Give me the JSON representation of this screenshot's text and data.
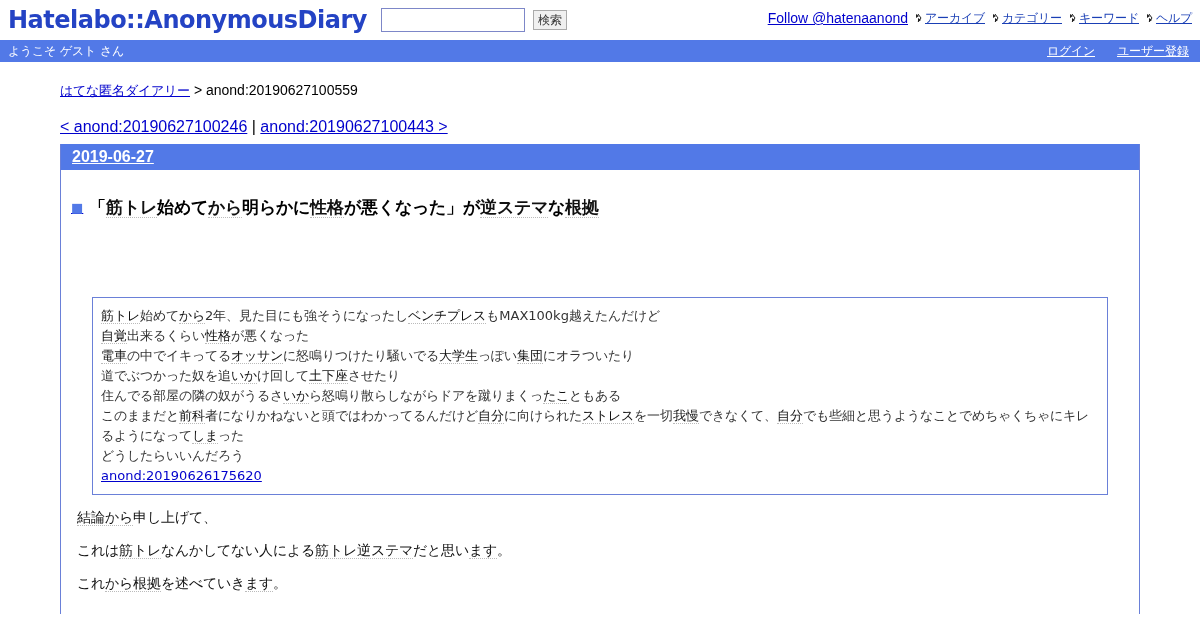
{
  "header": {
    "logo": "Hatelabo::AnonymousDiary",
    "search": {
      "button": "検索"
    },
    "follow": "Follow @hatenaanond",
    "nav": [
      "アーカイブ",
      "カテゴリー",
      "キーワード",
      "ヘルプ"
    ]
  },
  "userbar": {
    "welcome": "ようこそ ゲスト さん",
    "links": [
      "ログイン",
      "ユーザー登録"
    ]
  },
  "breadcrumb": {
    "link": "はてな匿名ダイアリー",
    "current": " > anond:20190627100559"
  },
  "pager": {
    "prev": "< anond:20190627100246",
    "separator": " | ",
    "next": "anond:20190627100443 >"
  },
  "day": {
    "date": "2019-06-27",
    "section": {
      "mark": "■",
      "title": [
        {
          "text": "「",
          "keyword": false
        },
        {
          "text": "筋トレ",
          "keyword": true
        },
        {
          "text": "始めて",
          "keyword": false
        },
        {
          "text": "から",
          "keyword": true
        },
        {
          "text": "明らかに",
          "keyword": false
        },
        {
          "text": "性格",
          "keyword": true
        },
        {
          "text": "が悪くなった」が",
          "keyword": false
        },
        {
          "text": "逆ステマ",
          "keyword": true
        },
        {
          "text": "な",
          "keyword": false
        },
        {
          "text": "根拠",
          "keyword": true
        }
      ],
      "quote": [
        [
          {
            "text": "筋トレ",
            "keyword": true
          },
          {
            "text": "始めて",
            "keyword": false
          },
          {
            "text": "から",
            "keyword": true
          },
          {
            "text": "2年、見た目にも強そうになったし",
            "keyword": false
          },
          {
            "text": "ベンチプレス",
            "keyword": true
          },
          {
            "text": "もMAX100kg越えたんだけど",
            "keyword": false
          }
        ],
        [
          {
            "text": "自覚",
            "keyword": true
          },
          {
            "text": "出来るくらい",
            "keyword": false
          },
          {
            "text": "性格",
            "keyword": true
          },
          {
            "text": "が悪くなった",
            "keyword": false
          }
        ],
        [
          {
            "text": "電車",
            "keyword": true
          },
          {
            "text": "の中でイキってる",
            "keyword": false
          },
          {
            "text": "オッサン",
            "keyword": true
          },
          {
            "text": "に怒鳴りつけたり騒いでる",
            "keyword": false
          },
          {
            "text": "大学生",
            "keyword": true
          },
          {
            "text": "っぽい",
            "keyword": false
          },
          {
            "text": "集団",
            "keyword": true
          },
          {
            "text": "にオラついたり",
            "keyword": false
          }
        ],
        [
          {
            "text": "道でぶつかった奴を追",
            "keyword": false
          },
          {
            "text": "いか",
            "keyword": true
          },
          {
            "text": "け回して",
            "keyword": false
          },
          {
            "text": "土下座",
            "keyword": true
          },
          {
            "text": "させたり",
            "keyword": false
          }
        ],
        [
          {
            "text": "住んでる部屋の隣の奴がうるさ",
            "keyword": false
          },
          {
            "text": "いか",
            "keyword": true
          },
          {
            "text": "ら怒鳴り散らしながらドアを蹴りまくっ",
            "keyword": false
          },
          {
            "text": "たこ",
            "keyword": true
          },
          {
            "text": "ともある",
            "keyword": false
          }
        ],
        [
          {
            "text": "このままだと",
            "keyword": false
          },
          {
            "text": "前科",
            "keyword": true
          },
          {
            "text": "者になりかねないと頭ではわかってるんだけど",
            "keyword": false
          },
          {
            "text": "自分",
            "keyword": true
          },
          {
            "text": "に向けられた",
            "keyword": false
          },
          {
            "text": "ストレス",
            "keyword": true
          },
          {
            "text": "を一切",
            "keyword": false
          },
          {
            "text": "我慢",
            "keyword": true
          },
          {
            "text": "できなくて、",
            "keyword": false
          },
          {
            "text": "自分",
            "keyword": true
          },
          {
            "text": "でも些細と思うようなことでめちゃくちゃにキレるようになって",
            "keyword": false
          },
          {
            "text": "しま",
            "keyword": true
          },
          {
            "text": "った",
            "keyword": false
          }
        ],
        [
          {
            "text": "どうしたらいいんだろう",
            "keyword": false
          }
        ]
      ],
      "quote_link": "anond:20190626175620",
      "paragraphs": [
        [
          {
            "text": "結論から",
            "keyword": true
          },
          {
            "text": "申し上げて、",
            "keyword": false
          }
        ],
        [
          {
            "text": "これは",
            "keyword": false
          },
          {
            "text": "筋トレ",
            "keyword": true
          },
          {
            "text": "なんかしてない人による",
            "keyword": false
          },
          {
            "text": "筋トレ逆ステマ",
            "keyword": true
          },
          {
            "text": "だと思い",
            "keyword": false
          },
          {
            "text": "ます",
            "keyword": true
          },
          {
            "text": "。",
            "keyword": false
          }
        ],
        [
          {
            "text": "これ",
            "keyword": false
          },
          {
            "text": "から根拠",
            "keyword": true
          },
          {
            "text": "を述べていき",
            "keyword": false
          },
          {
            "text": "ます",
            "keyword": true
          },
          {
            "text": "。",
            "keyword": false
          }
        ]
      ]
    }
  }
}
